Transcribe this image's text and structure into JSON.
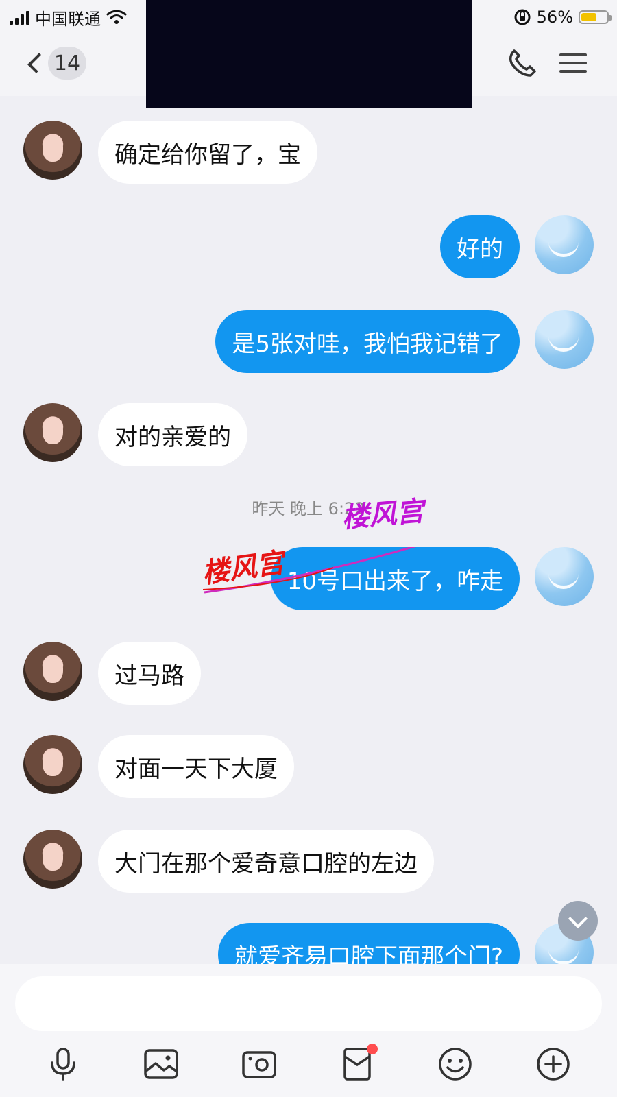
{
  "status_bar": {
    "carrier": "中国联通",
    "battery_percent": "56%"
  },
  "header": {
    "back_badge": "14"
  },
  "messages": [
    {
      "side": "left",
      "text": "确定给你留了，宝"
    },
    {
      "side": "right",
      "text": "好的"
    },
    {
      "side": "right",
      "text": "是5张对哇，我怕我记错了"
    },
    {
      "side": "left",
      "text": "对的亲爱的"
    },
    {
      "side": "right",
      "text": "10号口出来了，咋走"
    },
    {
      "side": "left",
      "text": "过马路"
    },
    {
      "side": "left",
      "text": "对面一天下大厦"
    },
    {
      "side": "left",
      "text": "大门在那个爱奇意口腔的左边"
    },
    {
      "side": "right",
      "text": "就爱齐易口腔下面那个门?"
    }
  ],
  "timestamp": "昨天 晚上 6:22",
  "watermark": "楼风宫",
  "toolbar": {
    "icons": [
      "microphone-icon",
      "image-icon",
      "camera-icon",
      "red-packet-icon",
      "emoji-icon",
      "plus-icon"
    ],
    "notification_dot": true
  }
}
